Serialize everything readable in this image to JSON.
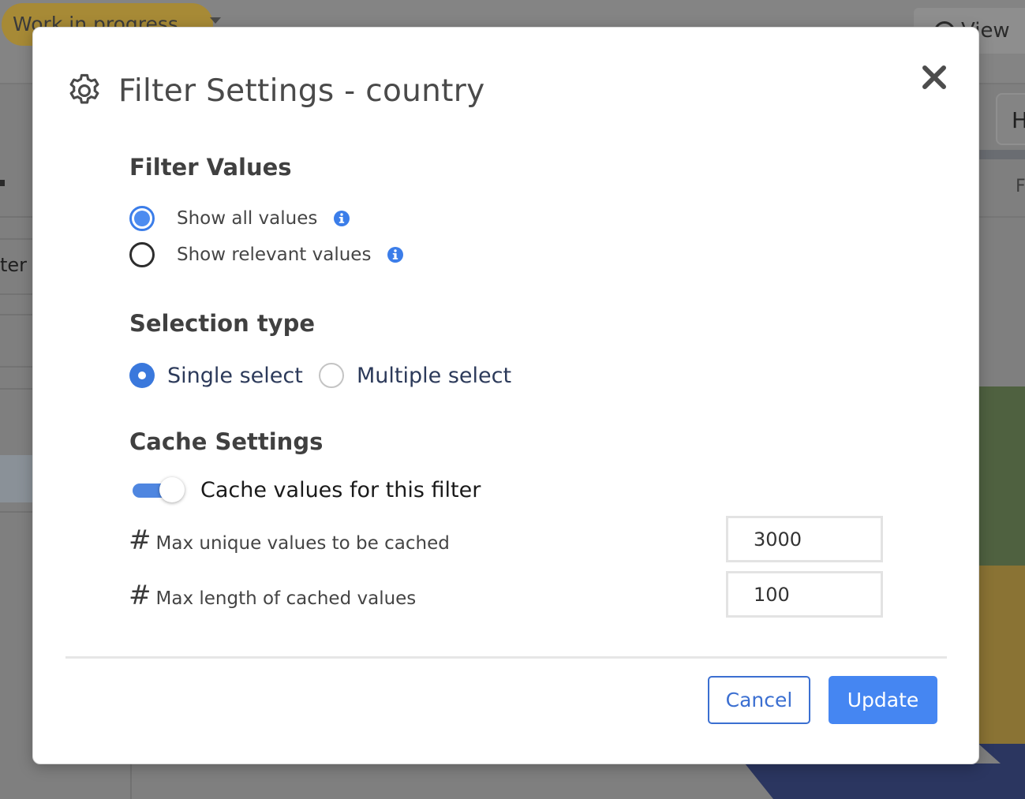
{
  "background": {
    "status_chip": "Work in progress",
    "view_button": "View",
    "right_button": "H",
    "right_column_letter": "F",
    "left_sidebar_fragment": "ter"
  },
  "modal": {
    "title": "Filter Settings - country",
    "filter_values": {
      "heading": "Filter Values",
      "options": [
        {
          "label": "Show all values",
          "selected": true
        },
        {
          "label": "Show relevant values",
          "selected": false
        }
      ]
    },
    "selection_type": {
      "heading": "Selection type",
      "options": [
        {
          "label": "Single select",
          "selected": true
        },
        {
          "label": "Multiple select",
          "selected": false
        }
      ]
    },
    "cache_settings": {
      "heading": "Cache Settings",
      "toggle_label": "Cache values for this filter",
      "toggle_on": true,
      "fields": [
        {
          "hash": "#",
          "label": "Max unique values to be cached",
          "value": "3000"
        },
        {
          "hash": "#",
          "label": "Max length of cached values",
          "value": "100"
        }
      ]
    },
    "buttons": {
      "cancel": "Cancel",
      "update": "Update"
    }
  },
  "colors": {
    "accent": "#4586f2",
    "radio_selected": "#3a78dc",
    "overlay": "#7f7f7f"
  }
}
